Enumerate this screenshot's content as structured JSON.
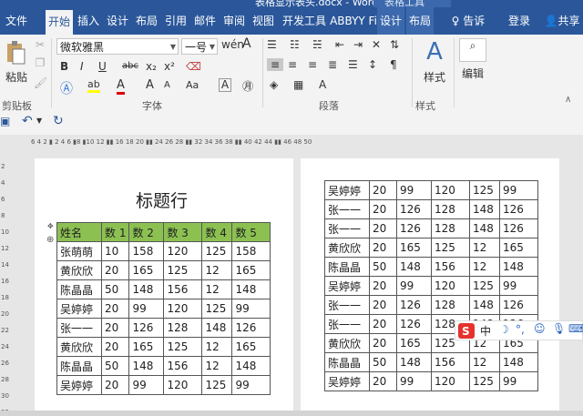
{
  "titlebar": {
    "document": "表格显示表头.docx - Word",
    "context": "表格工具"
  },
  "tabs": [
    "文件",
    "开始",
    "插入",
    "设计",
    "布局",
    "引用",
    "邮件",
    "审阅",
    "视图",
    "开发工具",
    "ABBYY Fi",
    "设计",
    "布局"
  ],
  "tell_me": "告诉我...",
  "login": "登录",
  "share": "共享",
  "ribbon": {
    "paste": "粘贴",
    "font_name": "微软雅黑",
    "font_size": "一号",
    "styles": "样式",
    "edit": "编辑",
    "groups": {
      "clipboard": "剪贴板",
      "font": "字体",
      "paragraph": "段落",
      "styles": "样式"
    },
    "buttons": {
      "bold": "B",
      "italic": "I",
      "underline": "U",
      "strike": "abc",
      "sub": "x₂",
      "sup": "x²",
      "grow": "A",
      "shrink": "A",
      "aa": "Aa",
      "clear": "A",
      "highlight": "ab",
      "color": "A",
      "phonetic": "A"
    }
  },
  "ruler": "6 4 2 ▮ 2 4 6 ▮8 ▮10 12 ▮▮ 16 18 20 ▮▮ 24 26 28 ▮▮ 32 34 36 38 ▮▮ 40 42 44 ▮▮ 46 48 50",
  "vruler": [
    "2",
    "4",
    "6",
    "8",
    "10",
    "12",
    "14",
    "16",
    "18",
    "20",
    "22",
    "24",
    "26",
    "28",
    "30",
    "32"
  ],
  "doc": {
    "title": "标题行",
    "header": [
      "姓名",
      "数 1",
      "数 2",
      "数 3",
      "数 4",
      "数 5"
    ],
    "rows_left": [
      [
        "张萌萌",
        "10",
        "158",
        "120",
        "125",
        "158"
      ],
      [
        "黄欣欣",
        "20",
        "165",
        "125",
        "12",
        "165"
      ],
      [
        "陈晶晶",
        "50",
        "148",
        "156",
        "12",
        "148"
      ],
      [
        "吴婷婷",
        "20",
        "99",
        "120",
        "125",
        "99"
      ],
      [
        "张一一",
        "20",
        "126",
        "128",
        "148",
        "126"
      ],
      [
        "黄欣欣",
        "20",
        "165",
        "125",
        "12",
        "165"
      ],
      [
        "陈晶晶",
        "50",
        "148",
        "156",
        "12",
        "148"
      ],
      [
        "吴婷婷",
        "20",
        "99",
        "120",
        "125",
        "99"
      ]
    ],
    "rows_right": [
      [
        "吴婷婷",
        "20",
        "99",
        "120",
        "125",
        "99"
      ],
      [
        "张一一",
        "20",
        "126",
        "128",
        "148",
        "126"
      ],
      [
        "张一一",
        "20",
        "126",
        "128",
        "148",
        "126"
      ],
      [
        "黄欣欣",
        "20",
        "165",
        "125",
        "12",
        "165"
      ],
      [
        "陈晶晶",
        "50",
        "148",
        "156",
        "12",
        "148"
      ],
      [
        "吴婷婷",
        "20",
        "99",
        "120",
        "125",
        "99"
      ],
      [
        "张一一",
        "20",
        "126",
        "128",
        "148",
        "126"
      ],
      [
        "张一一",
        "20",
        "126",
        "128",
        "148",
        "126"
      ],
      [
        "黄欣欣",
        "20",
        "165",
        "125",
        "12",
        "165"
      ],
      [
        "陈晶晶",
        "50",
        "148",
        "156",
        "12",
        "148"
      ],
      [
        "吴婷婷",
        "20",
        "99",
        "120",
        "125",
        "99"
      ]
    ]
  },
  "ime": {
    "lang": "中"
  },
  "colors": {
    "accent": "#2b579a",
    "header_fill": "#8cc152",
    "ime_red": "#e5322d"
  }
}
